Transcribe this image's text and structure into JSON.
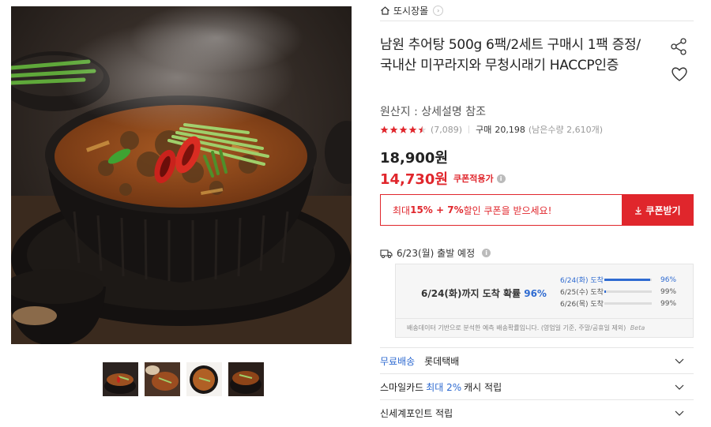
{
  "shop": {
    "name": "또시장몰"
  },
  "product": {
    "title": "남원 추어탕 500g 6팩/2세트 구매시 1팩 증정/국내산 미꾸라지와 무청시래기 HACCP인증",
    "origin": "원산지 : 상세설명 참조",
    "rating": 4.5,
    "review_count": "(7,089)",
    "buy_label": "구매",
    "buy_count": "20,198",
    "stock_text": "(남은수량 2,610개)",
    "original_price": "18,900원",
    "sale_price": "14,730원",
    "coupon_applied": "쿠폰적용가"
  },
  "coupon": {
    "msg_prefix": "최대 ",
    "msg_bold": "15% + 7%",
    "msg_suffix": " 할인 쿠폰을 받으세요!",
    "button_label": "쿠폰받기"
  },
  "shipping": {
    "departure": "6/23(월) 출발 예정",
    "arrival_text": "6/24(화)까지 도착 확률",
    "arrival_pct": "96%",
    "probabilities": [
      {
        "date": "6/24(화) 도착",
        "pct": "96%",
        "value": 0.96,
        "active": true
      },
      {
        "date": "6/25(수) 도착",
        "pct": "99%",
        "value": 0.03,
        "active": false
      },
      {
        "date": "6/26(목) 도착",
        "pct": "99%",
        "value": 0.0,
        "active": false
      }
    ],
    "note": "배송데이터 기반으로 분석한 예측 배송확률입니다. (영업일 기준, 주말/공휴일 제외)",
    "beta": "Beta"
  },
  "accordions": {
    "free_ship": "무료배송",
    "courier": "롯데택배",
    "smile_prefix": "스마일카드 ",
    "smile_blue": "최대 2%",
    "smile_suffix": " 캐시 적립",
    "shinsegae": "신세계포인트 적립"
  },
  "colors": {
    "accent_red": "#e0262c",
    "accent_blue": "#2f6bd1"
  }
}
